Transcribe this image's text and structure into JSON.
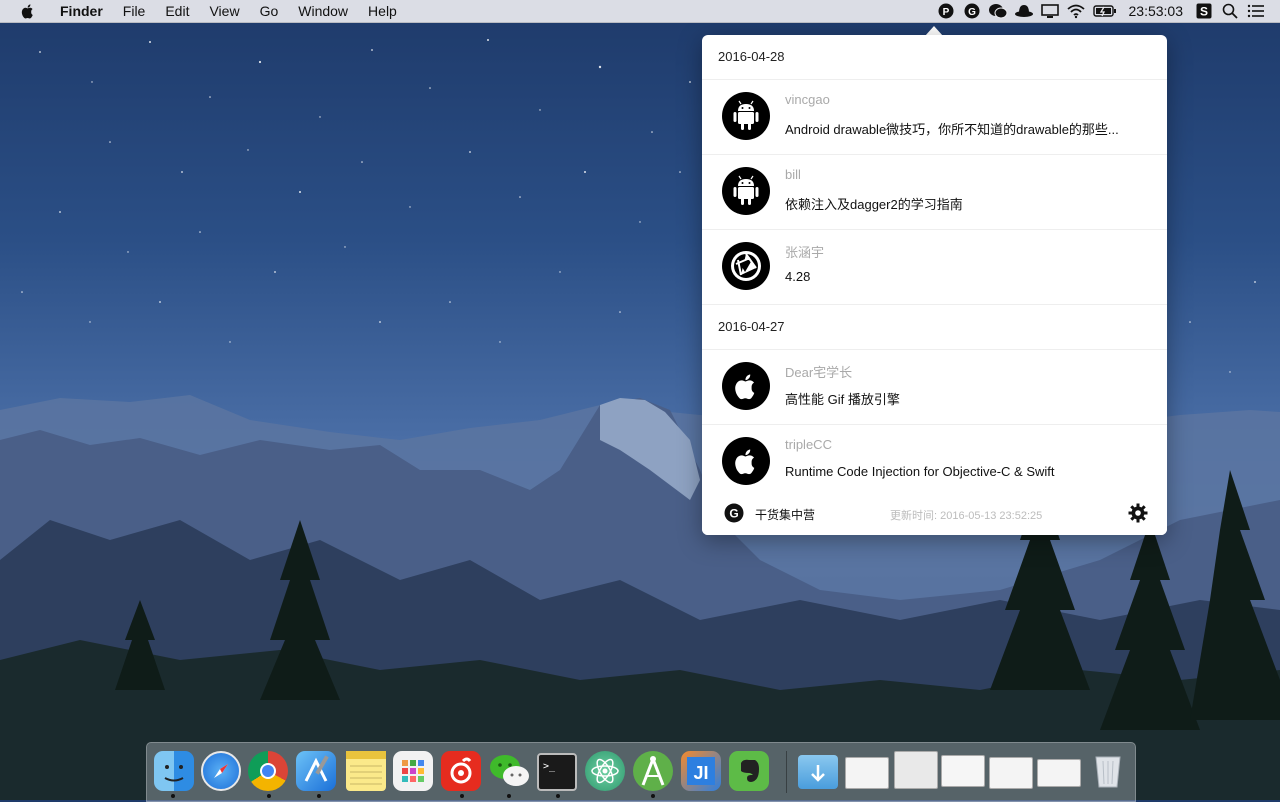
{
  "menubar": {
    "app_name": "Finder",
    "items": [
      "File",
      "Edit",
      "View",
      "Go",
      "Window",
      "Help"
    ],
    "clock": "23:53:03",
    "status_icons": [
      "p-icon",
      "g-app-icon",
      "wechat-icon",
      "hat-icon",
      "display-icon",
      "wifi-icon",
      "battery-icon",
      "s-icon",
      "search-icon",
      "list-icon"
    ]
  },
  "popover": {
    "sections": [
      {
        "date": "2016-04-28",
        "items": [
          {
            "author": "vincgao",
            "title": " Android drawable微技巧，你所不知道的drawable的那些...",
            "icon": "android-icon"
          },
          {
            "author": "bill",
            "title": "依赖注入及dagger2的学习指南",
            "icon": "android-icon"
          },
          {
            "author": "张涵宇",
            "title": "4.28",
            "icon": "aperture-icon"
          }
        ]
      },
      {
        "date": "2016-04-27",
        "items": [
          {
            "author": "Dear宅学长",
            "title": "高性能 Gif 播放引擎",
            "icon": "apple-icon"
          },
          {
            "author": "tripleCC",
            "title": "Runtime Code Injection for Objective-C & Swift",
            "icon": "apple-icon"
          }
        ]
      }
    ],
    "footer": {
      "app_name": "干货集中营",
      "updated": "更新时间: 2016-05-13 23:52:25"
    }
  },
  "dock": {
    "apps": [
      "finder-icon",
      "safari-icon",
      "chrome-icon",
      "xcode-icon",
      "notes-icon",
      "launchpad-icon",
      "netease-music-icon",
      "wechat-icon",
      "terminal-icon",
      "atom-icon",
      "android-studio-icon",
      "jetbrains-icon",
      "evernote-icon",
      "downloads-folder-icon",
      "window-preview-1",
      "window-preview-2",
      "window-preview-3",
      "window-preview-4",
      "window-preview-5",
      "trash-icon"
    ]
  },
  "colors": {
    "menubar_bg": "#ececf0",
    "popover_bg": "#ffffff",
    "author_text": "#a9a9a9"
  }
}
